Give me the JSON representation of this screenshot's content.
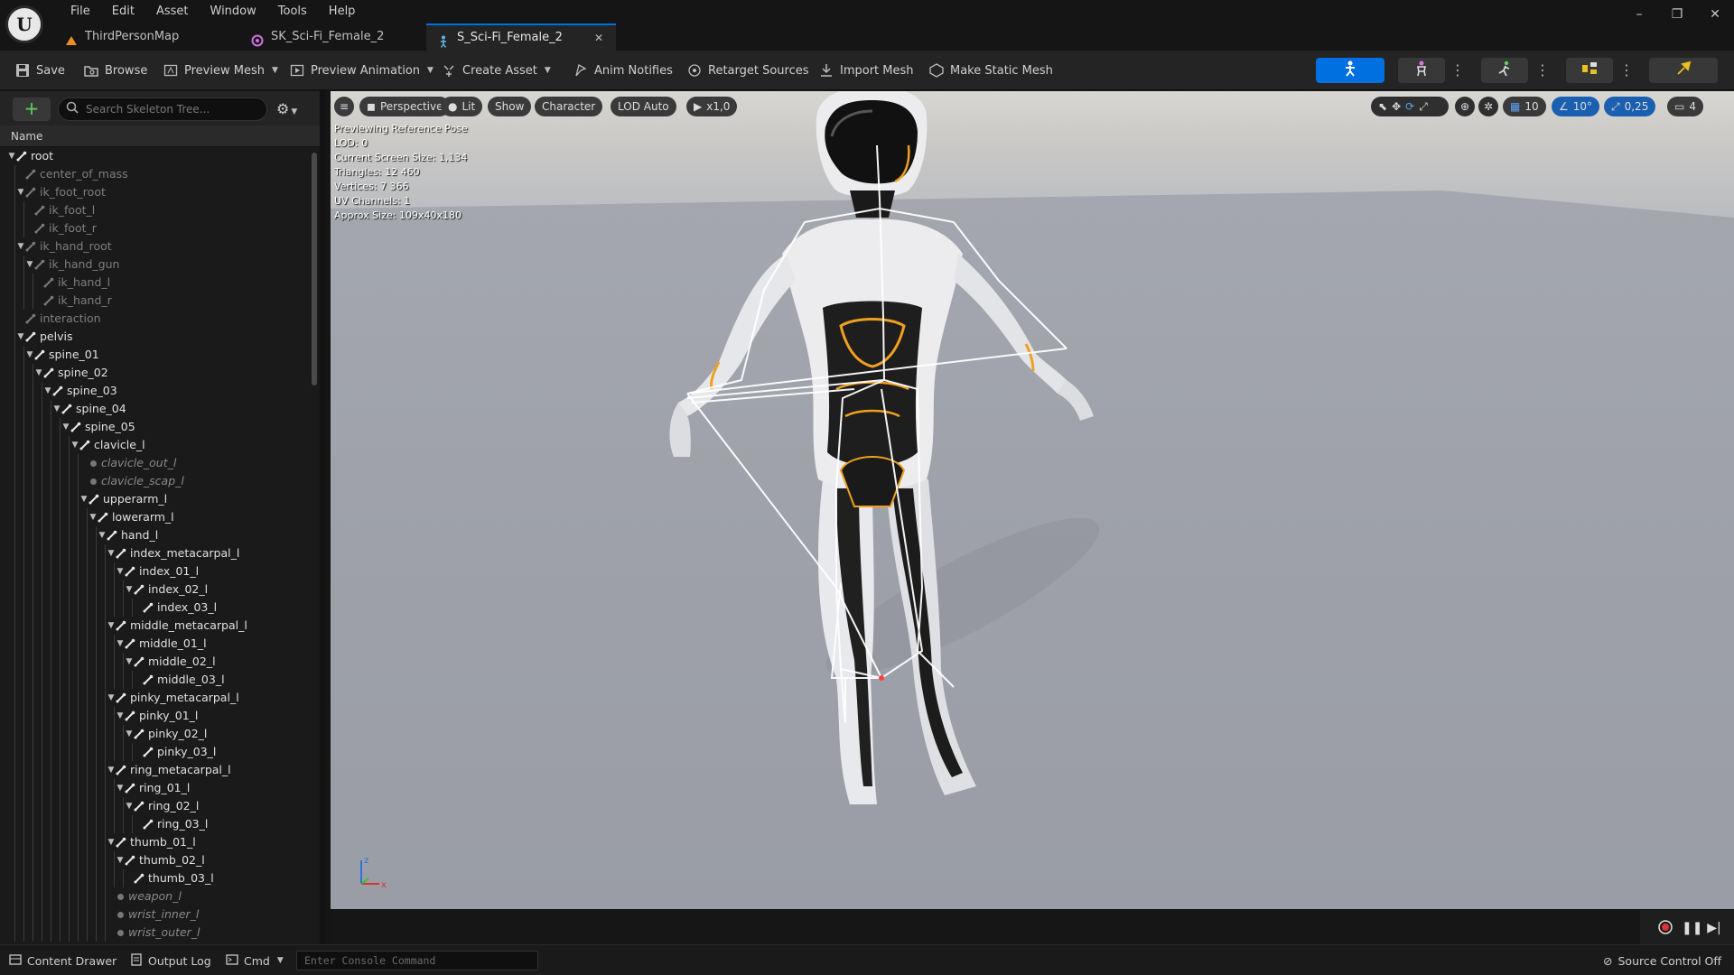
{
  "menu": {
    "items": [
      "File",
      "Edit",
      "Asset",
      "Window",
      "Tools",
      "Help"
    ]
  },
  "tabs": [
    {
      "label": "ThirdPersonMap",
      "icon": "level-icon",
      "active": false
    },
    {
      "label": "SK_Sci-Fi_Female_2",
      "icon": "skeletal-mesh-icon",
      "active": false
    },
    {
      "label": "S_Sci-Fi_Female_2",
      "icon": "skeleton-icon",
      "active": true
    }
  ],
  "toolbar": {
    "save": "Save",
    "browse": "Browse",
    "preview_mesh": "Preview Mesh",
    "preview_animation": "Preview Animation",
    "create_asset": "Create Asset",
    "anim_notifies": "Anim Notifies",
    "retarget_sources": "Retarget Sources",
    "import_mesh": "Import Mesh",
    "make_static_mesh": "Make Static Mesh"
  },
  "skeleton_tree": {
    "search_placeholder": "Search Skeleton Tree...",
    "column_name": "Name",
    "rows": [
      {
        "label": "root",
        "depth": 0,
        "kind": "bone",
        "expanded": true
      },
      {
        "label": "center_of_mass",
        "depth": 1,
        "kind": "virtual",
        "expanded": null
      },
      {
        "label": "ik_foot_root",
        "depth": 1,
        "kind": "virtual",
        "expanded": true
      },
      {
        "label": "ik_foot_l",
        "depth": 2,
        "kind": "virtual",
        "expanded": null
      },
      {
        "label": "ik_foot_r",
        "depth": 2,
        "kind": "virtual",
        "expanded": null
      },
      {
        "label": "ik_hand_root",
        "depth": 1,
        "kind": "virtual",
        "expanded": true
      },
      {
        "label": "ik_hand_gun",
        "depth": 2,
        "kind": "virtual",
        "expanded": true
      },
      {
        "label": "ik_hand_l",
        "depth": 3,
        "kind": "virtual",
        "expanded": null
      },
      {
        "label": "ik_hand_r",
        "depth": 3,
        "kind": "virtual",
        "expanded": null
      },
      {
        "label": "interaction",
        "depth": 1,
        "kind": "virtual",
        "expanded": null
      },
      {
        "label": "pelvis",
        "depth": 1,
        "kind": "bone",
        "expanded": true
      },
      {
        "label": "spine_01",
        "depth": 2,
        "kind": "bone",
        "expanded": true
      },
      {
        "label": "spine_02",
        "depth": 3,
        "kind": "bone",
        "expanded": true
      },
      {
        "label": "spine_03",
        "depth": 4,
        "kind": "bone",
        "expanded": true
      },
      {
        "label": "spine_04",
        "depth": 5,
        "kind": "bone",
        "expanded": true
      },
      {
        "label": "spine_05",
        "depth": 6,
        "kind": "bone",
        "expanded": true
      },
      {
        "label": "clavicle_l",
        "depth": 7,
        "kind": "bone",
        "expanded": true
      },
      {
        "label": "clavicle_out_l",
        "depth": 8,
        "kind": "socket",
        "expanded": null
      },
      {
        "label": "clavicle_scap_l",
        "depth": 8,
        "kind": "socket",
        "expanded": null
      },
      {
        "label": "upperarm_l",
        "depth": 8,
        "kind": "bone",
        "expanded": true
      },
      {
        "label": "lowerarm_l",
        "depth": 9,
        "kind": "bone",
        "expanded": true
      },
      {
        "label": "hand_l",
        "depth": 10,
        "kind": "bone",
        "expanded": true
      },
      {
        "label": "index_metacarpal_l",
        "depth": 11,
        "kind": "bone",
        "expanded": true
      },
      {
        "label": "index_01_l",
        "depth": 12,
        "kind": "bone",
        "expanded": true
      },
      {
        "label": "index_02_l",
        "depth": 13,
        "kind": "bone",
        "expanded": true
      },
      {
        "label": "index_03_l",
        "depth": 14,
        "kind": "bone",
        "expanded": null
      },
      {
        "label": "middle_metacarpal_l",
        "depth": 11,
        "kind": "bone",
        "expanded": true
      },
      {
        "label": "middle_01_l",
        "depth": 12,
        "kind": "bone",
        "expanded": true
      },
      {
        "label": "middle_02_l",
        "depth": 13,
        "kind": "bone",
        "expanded": true
      },
      {
        "label": "middle_03_l",
        "depth": 14,
        "kind": "bone",
        "expanded": null
      },
      {
        "label": "pinky_metacarpal_l",
        "depth": 11,
        "kind": "bone",
        "expanded": true
      },
      {
        "label": "pinky_01_l",
        "depth": 12,
        "kind": "bone",
        "expanded": true
      },
      {
        "label": "pinky_02_l",
        "depth": 13,
        "kind": "bone",
        "expanded": true
      },
      {
        "label": "pinky_03_l",
        "depth": 14,
        "kind": "bone",
        "expanded": null
      },
      {
        "label": "ring_metacarpal_l",
        "depth": 11,
        "kind": "bone",
        "expanded": true
      },
      {
        "label": "ring_01_l",
        "depth": 12,
        "kind": "bone",
        "expanded": true
      },
      {
        "label": "ring_02_l",
        "depth": 13,
        "kind": "bone",
        "expanded": true
      },
      {
        "label": "ring_03_l",
        "depth": 14,
        "kind": "bone",
        "expanded": null
      },
      {
        "label": "thumb_01_l",
        "depth": 11,
        "kind": "bone",
        "expanded": true
      },
      {
        "label": "thumb_02_l",
        "depth": 12,
        "kind": "bone",
        "expanded": true
      },
      {
        "label": "thumb_03_l",
        "depth": 13,
        "kind": "bone",
        "expanded": null
      },
      {
        "label": "weapon_l",
        "depth": 11,
        "kind": "socket",
        "expanded": null
      },
      {
        "label": "wrist_inner_l",
        "depth": 11,
        "kind": "socket",
        "expanded": null
      },
      {
        "label": "wrist_outer_l",
        "depth": 11,
        "kind": "socket",
        "expanded": null
      }
    ]
  },
  "viewport": {
    "perspective": "Perspective",
    "lit": "Lit",
    "show": "Show",
    "character": "Character",
    "lod": "LOD Auto",
    "play_rate": "x1,0",
    "grid_snap": "10",
    "rotation_snap": "10°",
    "scale_snap": "0,25",
    "camera_speed": "4",
    "stats": [
      "Previewing Reference Pose",
      "LOD: 0",
      "Current Screen Size: 1,134",
      "Triangles: 12 460",
      "Vertices: 7 366",
      "UV Channels: 1",
      "Approx Size: 109x40x180"
    ],
    "axis_labels": {
      "z": "z",
      "x": "x"
    }
  },
  "statusbar": {
    "content_drawer": "Content Drawer",
    "output_log": "Output Log",
    "cmd": "Cmd",
    "console_placeholder": "Enter Console Command",
    "source_control": "Source Control Off"
  },
  "colors": {
    "accent_blue": "#0070e0",
    "add_green": "#5ed35e",
    "suit_orange": "#f0a020"
  }
}
